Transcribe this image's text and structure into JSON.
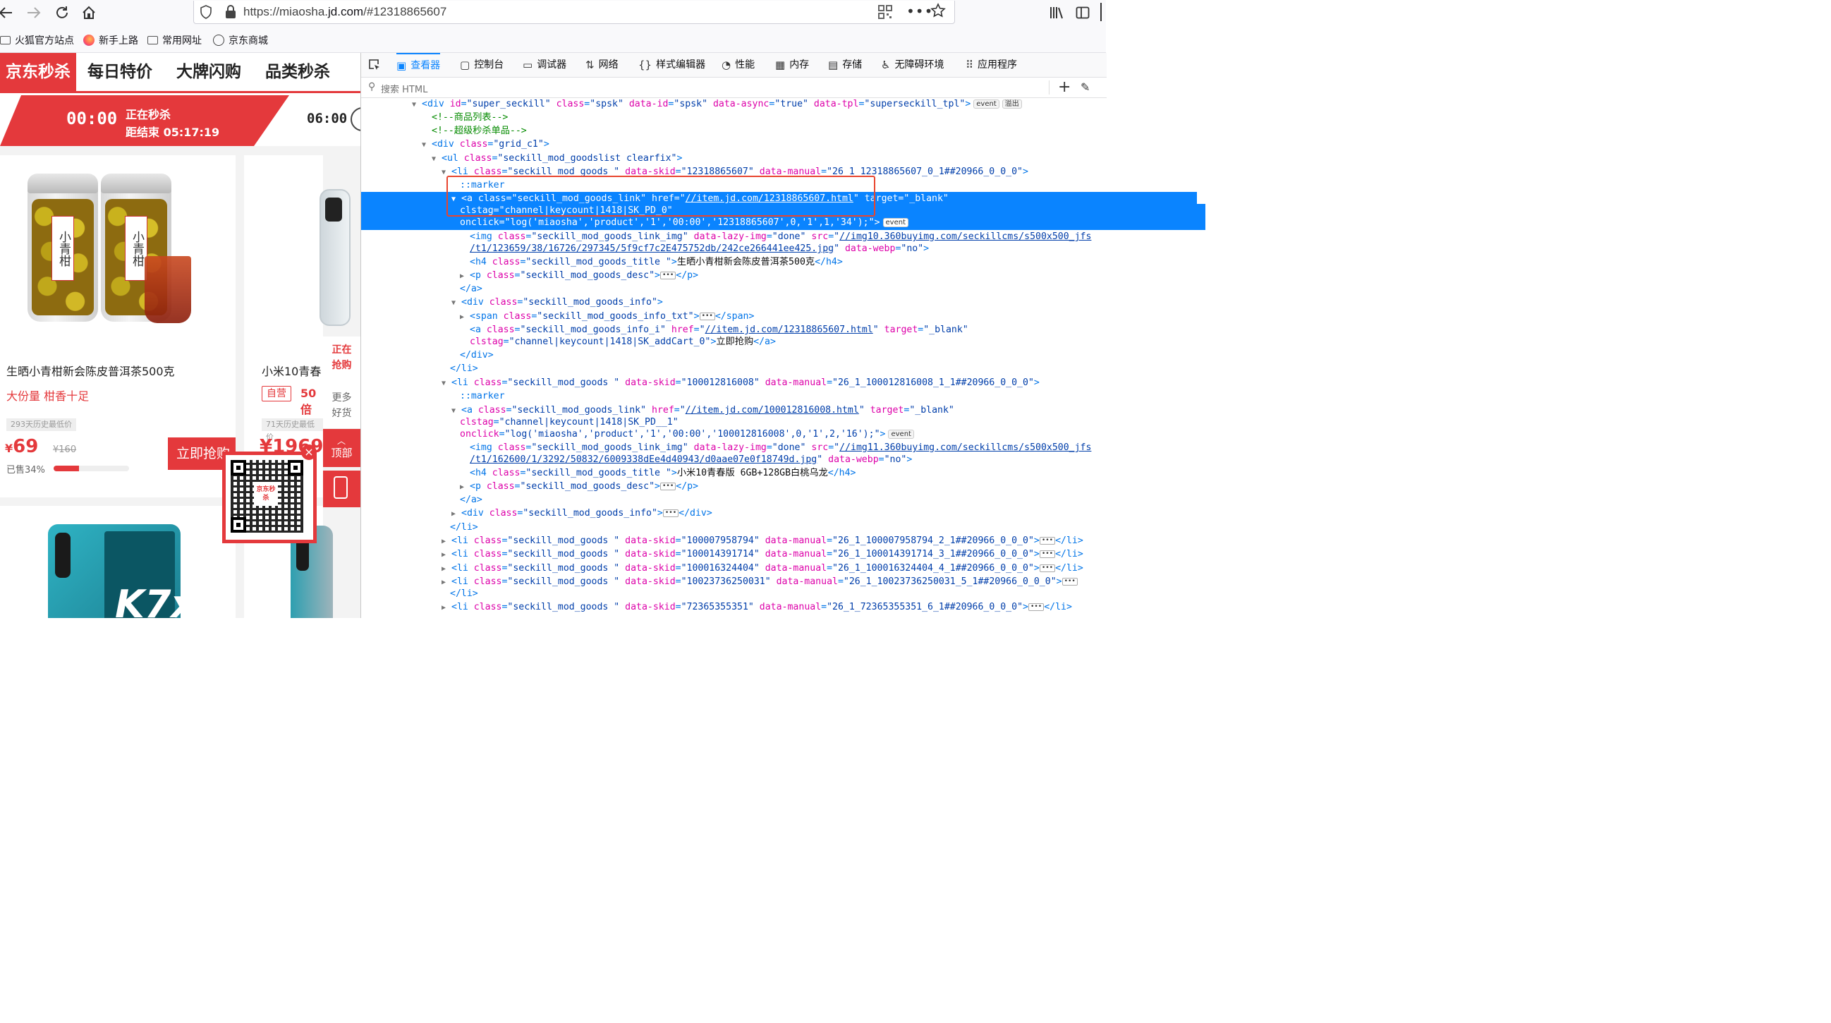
{
  "browser": {
    "url_prefix": "https://miaosha.",
    "url_domain": "jd.com",
    "url_suffix": "/#12318865607",
    "bookmarks": [
      {
        "label": "火狐官方站点",
        "icon": "folder-icon"
      },
      {
        "label": "新手上路",
        "icon": "firefox-icon"
      },
      {
        "label": "常用网址",
        "icon": "folder-icon"
      },
      {
        "label": "京东商城",
        "icon": "globe-icon"
      }
    ]
  },
  "jd": {
    "nav": [
      "京东秒杀",
      "每日特价",
      "大牌闪购",
      "品类秒杀"
    ],
    "time_slot": "00:00",
    "status": "正在秒杀",
    "countdown": "距结束 05:17:19",
    "next_slot": "06:00",
    "product1": {
      "jar_label": "小青柑",
      "title": "生晒小青柑新会陈皮普洱茶500克",
      "subtitle": "大份量 柑香十足",
      "history": "293天历史最低价",
      "price_symbol": "¥",
      "price": "69",
      "orig_price": "¥160",
      "sold": "已售34%",
      "sold_pct": 34,
      "buy_label": "立即抢购"
    },
    "product2": {
      "title": "小米10青春",
      "self_badge": "自营",
      "subtitle_frag": "50倍",
      "history": "71天历史最低价",
      "price": "¥1969"
    },
    "product3": {
      "text": "K7x"
    },
    "side": {
      "now": [
        "正在",
        "抢购"
      ],
      "more": [
        "更多",
        "好货"
      ],
      "top": "顶部"
    },
    "qr_logo": "京东秒杀"
  },
  "devtools": {
    "tabs": [
      {
        "label": "查看器",
        "icon": "inspector-icon",
        "active": true
      },
      {
        "label": "控制台",
        "icon": "console-icon"
      },
      {
        "label": "调试器",
        "icon": "debugger-icon"
      },
      {
        "label": "网络",
        "icon": "network-icon"
      },
      {
        "label": "样式编辑器",
        "icon": "style-editor-icon"
      },
      {
        "label": "性能",
        "icon": "performance-icon"
      },
      {
        "label": "内存",
        "icon": "memory-icon"
      },
      {
        "label": "存储",
        "icon": "storage-icon"
      },
      {
        "label": "无障碍环境",
        "icon": "accessibility-icon"
      },
      {
        "label": "应用程序",
        "icon": "application-icon"
      }
    ],
    "search_placeholder": "搜索 HTML",
    "badges": {
      "event": "event",
      "overflow": "溢出"
    },
    "lines": {
      "l1": {
        "tag": "div",
        "attrs": [
          [
            "id",
            "super_seckill"
          ],
          [
            "class",
            "spsk"
          ],
          [
            "data-id",
            "spsk"
          ],
          [
            "data-async",
            "true"
          ],
          [
            "data-tpl",
            "superseckill_tpl"
          ]
        ]
      },
      "c1": "<!--商品列表-->",
      "c2": "<!--超级秒杀单品-->",
      "l4": {
        "tag": "div",
        "attrs": [
          [
            "class",
            "grid_c1"
          ]
        ]
      },
      "l5": {
        "tag": "ul",
        "attrs": [
          [
            "class",
            "seckill_mod_goodslist clearfix"
          ]
        ]
      },
      "l6": {
        "tag": "li",
        "attrs": [
          [
            "class",
            "seckill_mod_goods "
          ],
          [
            "data-skid",
            "12318865607"
          ],
          [
            "data-manual",
            "26_1_12318865607_0_1##20966_0_0_0"
          ]
        ]
      },
      "marker": "::marker",
      "a1_href": "//item.jd.com/12318865607.html",
      "a1_clstag": "channel|keycount|1418|SK_PD_0",
      "a1_onclick": "log('miaosha','product','1','00:00','12318865607',0,'1',1,'34');",
      "img1_src_a": "//img10.360buyimg.com/seckillcms/s500x500_jfs",
      "img1_src_b": "/t1/123659/38/16726/297345/5f9cf7c2E475752db/242ce266441ee425.jpg",
      "h4_1": "生晒小青柑新会陈皮普洱茶500克",
      "info_href": "//item.jd.com/12318865607.html",
      "info_clstag": "channel|keycount|1418|SK_addCart_0",
      "info_text": "立即抢购",
      "li2_skid": "100012816008",
      "li2_manual": "26_1_100012816008_1_1##20966_0_0_0",
      "a2_href": "//item.jd.com/100012816008.html",
      "a2_clstag": "channel|keycount|1418|SK_PD__1",
      "a2_onclick": "log('miaosha','product','1','00:00','100012816008',0,'1',2,'16');",
      "img2_src_a": "//img11.360buyimg.com/seckillcms/s500x500_jfs",
      "img2_src_b": "/t1/162600/1/3292/50832/6009338dEe4d40943/d0aae07e0f18749d.jpg",
      "h4_2": "小米10青春版 6GB+128GB白桃乌龙",
      "li3": [
        "100007958794",
        "26_1_100007958794_2_1##20966_0_0_0"
      ],
      "li4": [
        "100014391714",
        "26_1_100014391714_3_1##20966_0_0_0"
      ],
      "li5": [
        "100016324404",
        "26_1_100016324404_4_1##20966_0_0_0"
      ],
      "li6": [
        "10023736250031",
        "26_1_10023736250031_5_1##20966_0_0_0"
      ],
      "li7": [
        "72365355351",
        "26_1_72365355351_6_1##20966_0_0_0"
      ]
    }
  },
  "colors": {
    "jd_red": "#e4393c",
    "devtools_blue": "#0a84ff"
  }
}
